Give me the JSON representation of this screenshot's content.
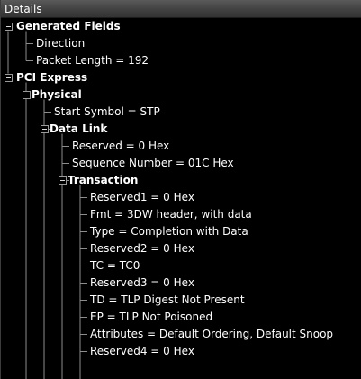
{
  "panel": {
    "title": "Details"
  },
  "tree": [
    {
      "label": "Generated Fields",
      "level": 0,
      "bold": true,
      "expanded": true
    },
    {
      "label": "Direction",
      "level": 1,
      "bold": false
    },
    {
      "label": "Packet Length = 192",
      "level": 1,
      "bold": false
    },
    {
      "label": "PCI Express",
      "level": 0,
      "bold": true,
      "expanded": true
    },
    {
      "label": "Physical",
      "level": 1,
      "bold": true,
      "expanded": true
    },
    {
      "label": "Start Symbol = STP",
      "level": 2,
      "bold": false
    },
    {
      "label": "Data Link",
      "level": 2,
      "bold": true,
      "expanded": true
    },
    {
      "label": "Reserved = 0 Hex",
      "level": 3,
      "bold": false
    },
    {
      "label": "Sequence Number = 01C Hex",
      "level": 3,
      "bold": false
    },
    {
      "label": "Transaction",
      "level": 3,
      "bold": true,
      "expanded": true
    },
    {
      "label": "Reserved1 = 0 Hex",
      "level": 4,
      "bold": false
    },
    {
      "label": "Fmt = 3DW header, with data",
      "level": 4,
      "bold": false
    },
    {
      "label": "Type = Completion with Data",
      "level": 4,
      "bold": false
    },
    {
      "label": "Reserved2 = 0 Hex",
      "level": 4,
      "bold": false
    },
    {
      "label": "TC = TC0",
      "level": 4,
      "bold": false
    },
    {
      "label": "Reserved3 = 0 Hex",
      "level": 4,
      "bold": false
    },
    {
      "label": "TD = TLP Digest Not Present",
      "level": 4,
      "bold": false
    },
    {
      "label": "EP = TLP Not Poisoned",
      "level": 4,
      "bold": false
    },
    {
      "label": "Attributes = Default Ordering, Default Snoop",
      "level": 4,
      "bold": false
    },
    {
      "label": "Reserved4 = 0 Hex",
      "level": 4,
      "bold": false
    }
  ],
  "colors": {
    "background": "#000000",
    "text": "#ffffff",
    "tree_lines": "#8c8c8c",
    "titlebar": "#444444"
  }
}
